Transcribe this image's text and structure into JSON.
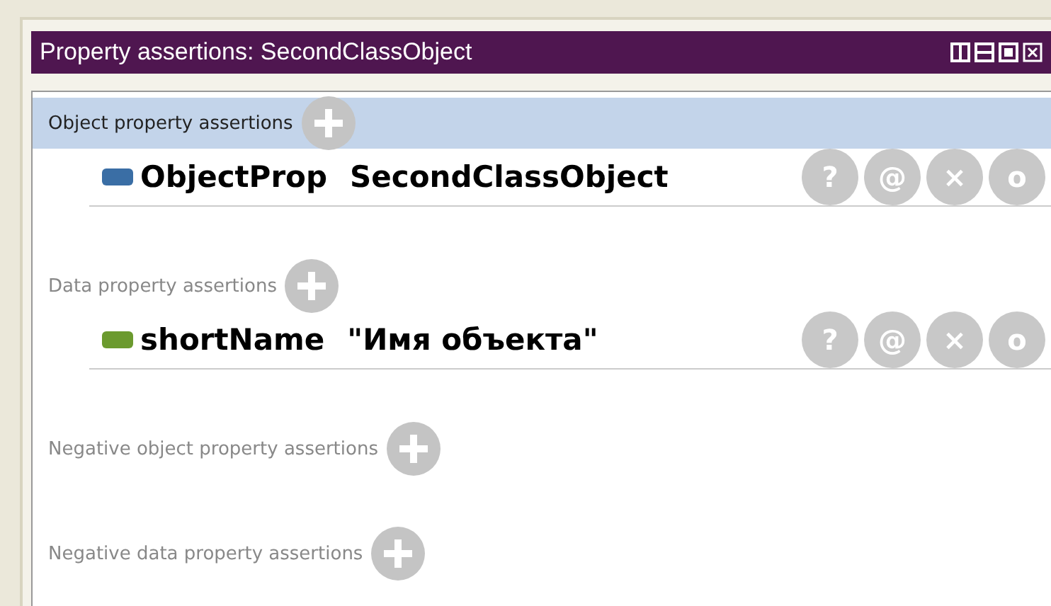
{
  "window": {
    "title": "Property assertions: SecondClassObject"
  },
  "sections": [
    {
      "label": "Object property assertions",
      "selected": true,
      "rows": [
        {
          "property": "ObjectProp",
          "value": "SecondClassObject",
          "color": "#3a6ea5",
          "buttons": [
            "?",
            "@",
            "×",
            "o"
          ]
        }
      ]
    },
    {
      "label": "Data property assertions",
      "selected": false,
      "rows": [
        {
          "property": "shortName",
          "value": "\"Имя объекта\"",
          "color": "#6b9a2e",
          "buttons": [
            "?",
            "@",
            "×",
            "o"
          ]
        }
      ]
    },
    {
      "label": "Negative object property assertions",
      "selected": false
    },
    {
      "label": "Negative data property assertions",
      "selected": false
    }
  ]
}
